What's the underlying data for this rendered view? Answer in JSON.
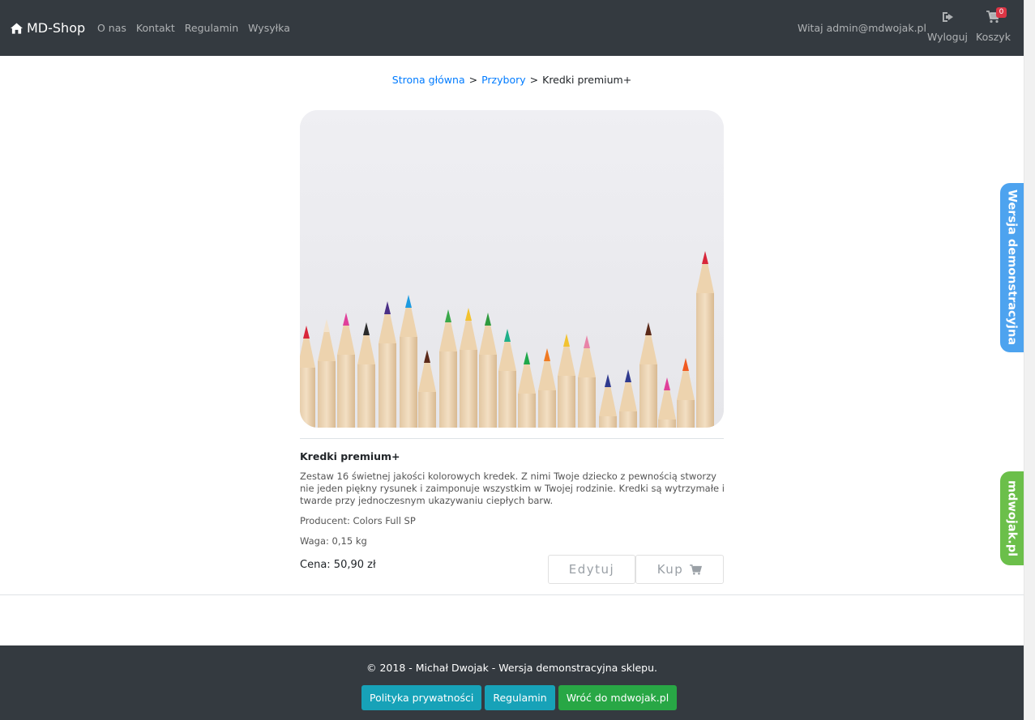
{
  "navbar": {
    "brand": "MD-Shop",
    "brand_icon": "home-icon",
    "links": [
      "O nas",
      "Kontakt",
      "Regulamin",
      "Wysyłka"
    ],
    "greeting": "Witaj admin@mdwojak.pl",
    "logout_label": "Wyloguj",
    "logout_icon": "sign-out-icon",
    "cart_label": "Koszyk",
    "cart_icon": "shopping-cart-icon",
    "cart_count": "0"
  },
  "breadcrumb": {
    "home": "Strona główna",
    "category": "Przybory",
    "current": "Kredki premium+",
    "separator": ">"
  },
  "product": {
    "name": "Kredki premium+",
    "description": "Zestaw 16 świetnej jakości kolorowych kredek. Z nimi Twoje dziecko z pewnością stworzy nie jeden piękny rysunek i zaimponuje wszystkim w Twojej rodzinie. Kredki są wytrzymałe i twarde przy jednoczesnym ukazywaniu ciepłych barw.",
    "producer": "Producent: Colors Full SP",
    "weight": "Waga: 0,15 kg",
    "price": "Cena: 50,90 zł",
    "edit_label": "Edytuj",
    "buy_label": "Kup",
    "buy_icon": "cart-plus-icon",
    "image": "colored-pencils-photo"
  },
  "side_tabs": {
    "demo": "Wersja demonstracyjna",
    "site": "mdwojak.pl"
  },
  "footer": {
    "copyright": "© 2018 - Michał Dwojak - Wersja demonstracyjna sklepu.",
    "buttons": [
      "Polityka prywatności",
      "Regulamin",
      "Wróć do mdwojak.pl"
    ]
  },
  "colors": {
    "navbar": "#343a40",
    "link": "#007bff",
    "info": "#17a2b8",
    "success": "#28a745",
    "tab_demo": "#4da3ef",
    "tab_site": "#6bbf4a"
  }
}
